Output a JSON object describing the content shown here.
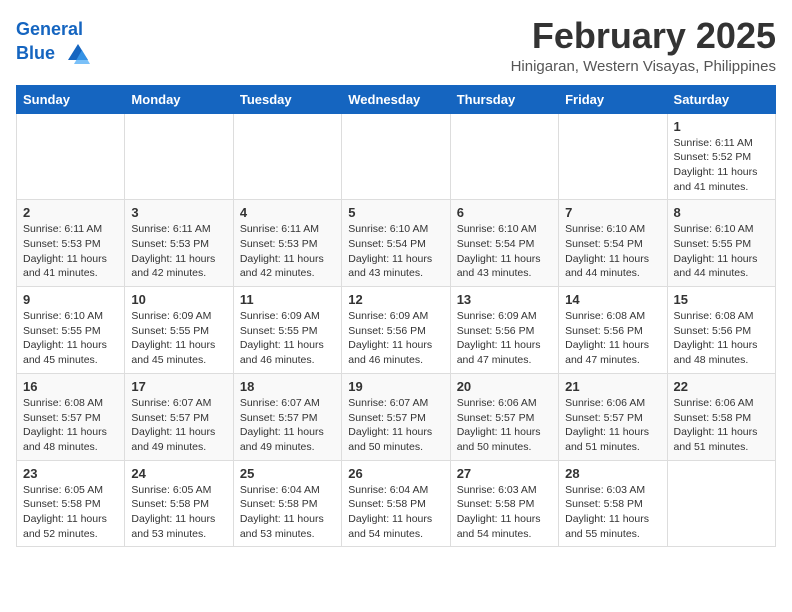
{
  "header": {
    "logo_line1": "General",
    "logo_line2": "Blue",
    "month_year": "February 2025",
    "location": "Hinigaran, Western Visayas, Philippines"
  },
  "days_of_week": [
    "Sunday",
    "Monday",
    "Tuesday",
    "Wednesday",
    "Thursday",
    "Friday",
    "Saturday"
  ],
  "weeks": [
    [
      {
        "day": "",
        "info": ""
      },
      {
        "day": "",
        "info": ""
      },
      {
        "day": "",
        "info": ""
      },
      {
        "day": "",
        "info": ""
      },
      {
        "day": "",
        "info": ""
      },
      {
        "day": "",
        "info": ""
      },
      {
        "day": "1",
        "info": "Sunrise: 6:11 AM\nSunset: 5:52 PM\nDaylight: 11 hours and 41 minutes."
      }
    ],
    [
      {
        "day": "2",
        "info": "Sunrise: 6:11 AM\nSunset: 5:53 PM\nDaylight: 11 hours and 41 minutes."
      },
      {
        "day": "3",
        "info": "Sunrise: 6:11 AM\nSunset: 5:53 PM\nDaylight: 11 hours and 42 minutes."
      },
      {
        "day": "4",
        "info": "Sunrise: 6:11 AM\nSunset: 5:53 PM\nDaylight: 11 hours and 42 minutes."
      },
      {
        "day": "5",
        "info": "Sunrise: 6:10 AM\nSunset: 5:54 PM\nDaylight: 11 hours and 43 minutes."
      },
      {
        "day": "6",
        "info": "Sunrise: 6:10 AM\nSunset: 5:54 PM\nDaylight: 11 hours and 43 minutes."
      },
      {
        "day": "7",
        "info": "Sunrise: 6:10 AM\nSunset: 5:54 PM\nDaylight: 11 hours and 44 minutes."
      },
      {
        "day": "8",
        "info": "Sunrise: 6:10 AM\nSunset: 5:55 PM\nDaylight: 11 hours and 44 minutes."
      }
    ],
    [
      {
        "day": "9",
        "info": "Sunrise: 6:10 AM\nSunset: 5:55 PM\nDaylight: 11 hours and 45 minutes."
      },
      {
        "day": "10",
        "info": "Sunrise: 6:09 AM\nSunset: 5:55 PM\nDaylight: 11 hours and 45 minutes."
      },
      {
        "day": "11",
        "info": "Sunrise: 6:09 AM\nSunset: 5:55 PM\nDaylight: 11 hours and 46 minutes."
      },
      {
        "day": "12",
        "info": "Sunrise: 6:09 AM\nSunset: 5:56 PM\nDaylight: 11 hours and 46 minutes."
      },
      {
        "day": "13",
        "info": "Sunrise: 6:09 AM\nSunset: 5:56 PM\nDaylight: 11 hours and 47 minutes."
      },
      {
        "day": "14",
        "info": "Sunrise: 6:08 AM\nSunset: 5:56 PM\nDaylight: 11 hours and 47 minutes."
      },
      {
        "day": "15",
        "info": "Sunrise: 6:08 AM\nSunset: 5:56 PM\nDaylight: 11 hours and 48 minutes."
      }
    ],
    [
      {
        "day": "16",
        "info": "Sunrise: 6:08 AM\nSunset: 5:57 PM\nDaylight: 11 hours and 48 minutes."
      },
      {
        "day": "17",
        "info": "Sunrise: 6:07 AM\nSunset: 5:57 PM\nDaylight: 11 hours and 49 minutes."
      },
      {
        "day": "18",
        "info": "Sunrise: 6:07 AM\nSunset: 5:57 PM\nDaylight: 11 hours and 49 minutes."
      },
      {
        "day": "19",
        "info": "Sunrise: 6:07 AM\nSunset: 5:57 PM\nDaylight: 11 hours and 50 minutes."
      },
      {
        "day": "20",
        "info": "Sunrise: 6:06 AM\nSunset: 5:57 PM\nDaylight: 11 hours and 50 minutes."
      },
      {
        "day": "21",
        "info": "Sunrise: 6:06 AM\nSunset: 5:57 PM\nDaylight: 11 hours and 51 minutes."
      },
      {
        "day": "22",
        "info": "Sunrise: 6:06 AM\nSunset: 5:58 PM\nDaylight: 11 hours and 51 minutes."
      }
    ],
    [
      {
        "day": "23",
        "info": "Sunrise: 6:05 AM\nSunset: 5:58 PM\nDaylight: 11 hours and 52 minutes."
      },
      {
        "day": "24",
        "info": "Sunrise: 6:05 AM\nSunset: 5:58 PM\nDaylight: 11 hours and 53 minutes."
      },
      {
        "day": "25",
        "info": "Sunrise: 6:04 AM\nSunset: 5:58 PM\nDaylight: 11 hours and 53 minutes."
      },
      {
        "day": "26",
        "info": "Sunrise: 6:04 AM\nSunset: 5:58 PM\nDaylight: 11 hours and 54 minutes."
      },
      {
        "day": "27",
        "info": "Sunrise: 6:03 AM\nSunset: 5:58 PM\nDaylight: 11 hours and 54 minutes."
      },
      {
        "day": "28",
        "info": "Sunrise: 6:03 AM\nSunset: 5:58 PM\nDaylight: 11 hours and 55 minutes."
      },
      {
        "day": "",
        "info": ""
      }
    ]
  ]
}
